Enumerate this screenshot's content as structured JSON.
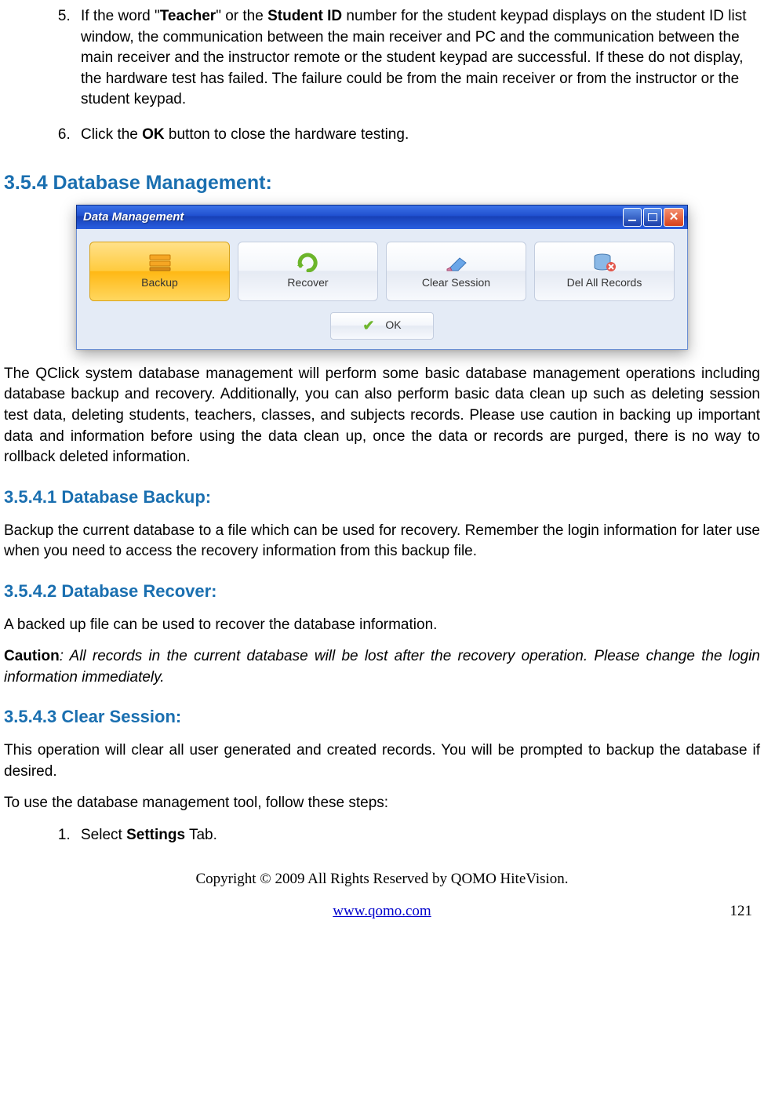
{
  "list_top": {
    "item5": {
      "prefix": "If the word \"",
      "teacher": "Teacher",
      "mid1": "\" or the ",
      "studentid": "Student ID",
      "rest": " number for the student keypad displays on the student ID list window, the communication between the main receiver and PC and the communication between the main receiver and the instructor remote or the student keypad are successful. If these do not display, the hardware test has failed. The failure could be from the main receiver or from the instructor or the student keypad."
    },
    "item6": {
      "prefix": "Click the ",
      "ok": "OK",
      "rest": " button to close the hardware testing."
    }
  },
  "section": {
    "title": "3.5.4 Database Management:"
  },
  "window": {
    "title": "Data Management",
    "buttons": {
      "backup": "Backup",
      "recover": "Recover",
      "clear": "Clear Session",
      "del": "Del All Records"
    },
    "ok": "OK"
  },
  "para_main": "The QClick system database management will perform some basic database management operations including database backup and recovery. Additionally, you can also perform basic data clean up such as deleting session test data, deleting students, teachers, classes, and subjects records. Please use caution in backing up important data and information before using the data clean up, once the data or records are purged, there is no way to rollback deleted information.",
  "sub1": {
    "title": "3.5.4.1 Database Backup:",
    "text": "Backup the current database to a file which can be used for recovery. Remember the login information for later use when you need to access the recovery information from this backup file."
  },
  "sub2": {
    "title": "3.5.4.2 Database Recover:",
    "text": "A backed up file can be used to recover the database information.",
    "caution_label": "Caution",
    "caution_text": ": All records in the current database will be lost after the recovery operation.  Please change the login information immediately."
  },
  "sub3": {
    "title": "3.5.4.3 Clear Session:",
    "text": "This operation will clear all user generated and created records. You will be prompted to backup the database if desired.",
    "steps_intro": "To use the database management tool, follow these steps:",
    "step1_prefix": "Select ",
    "step1_bold": "Settings",
    "step1_suffix": " Tab."
  },
  "footer": {
    "copyright": "Copyright © 2009 All Rights Reserved by QOMO HiteVision.",
    "link": "www.qomo.com",
    "page": "121"
  }
}
